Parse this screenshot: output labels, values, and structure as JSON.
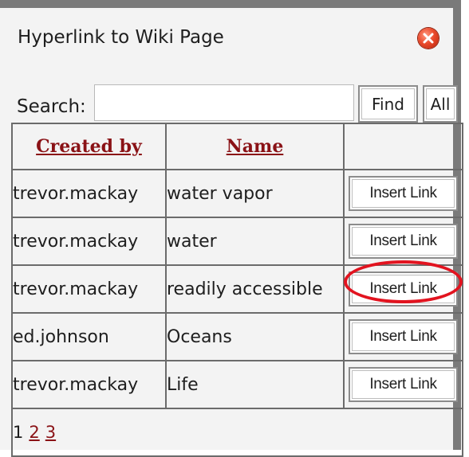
{
  "dialog": {
    "title": "Hyperlink to Wiki Page",
    "close_icon": "close-icon"
  },
  "search": {
    "label": "Search:",
    "value": "",
    "find_label": "Find",
    "all_label": "All"
  },
  "table": {
    "headers": [
      "Created by",
      "Name",
      ""
    ],
    "rows": [
      {
        "created_by": "trevor.mackay",
        "name": "water vapor",
        "action": "Insert Link"
      },
      {
        "created_by": "trevor.mackay",
        "name": "water",
        "action": "Insert Link"
      },
      {
        "created_by": "trevor.mackay",
        "name": "readily accessible",
        "action": "Insert Link"
      },
      {
        "created_by": "ed.johnson",
        "name": "Oceans",
        "action": "Insert Link"
      },
      {
        "created_by": "trevor.mackay",
        "name": "Life",
        "action": "Insert Link"
      }
    ]
  },
  "pagination": {
    "current": "1",
    "pages": [
      "2",
      "3"
    ]
  },
  "colors": {
    "link": "#8a1216",
    "highlight": "#e2131f",
    "border": "#7a7a7a"
  }
}
